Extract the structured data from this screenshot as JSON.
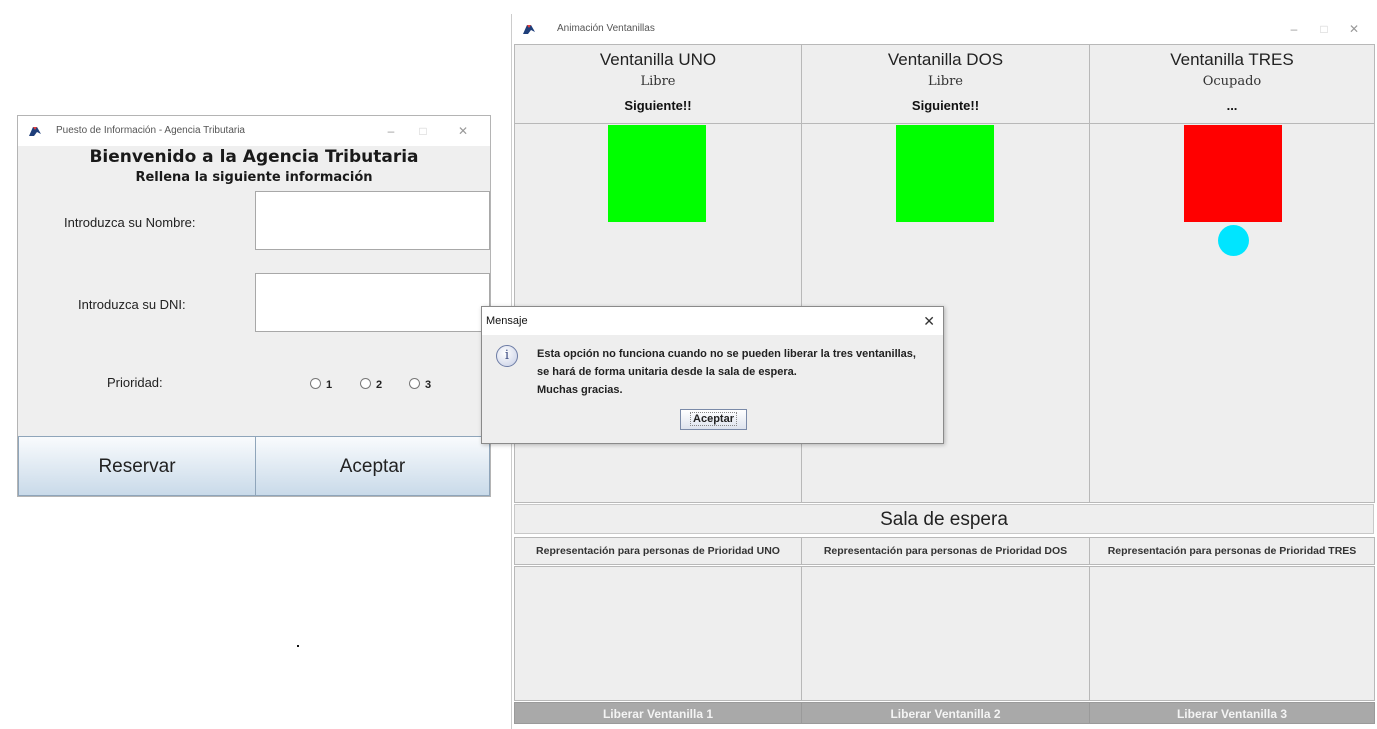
{
  "animation_window": {
    "title": "Animación Ventanillas",
    "controls": {
      "minimize": "–",
      "maximize": "□",
      "close": "✕"
    },
    "windows": [
      {
        "name": "Ventanilla UNO",
        "state": "Libre",
        "next": "Siguiente!!",
        "status_color": "#00ff00",
        "has_client": false
      },
      {
        "name": "Ventanilla DOS",
        "state": "Libre",
        "next": "Siguiente!!",
        "status_color": "#00ff00",
        "has_client": false
      },
      {
        "name": "Ventanilla TRES",
        "state": "Ocupado",
        "next": "...",
        "status_color": "#ff0000",
        "has_client": true
      }
    ],
    "client_color": "#00e5ff",
    "waiting_room": {
      "title": "Sala de espera",
      "headers": [
        "Representación para personas de Prioridad UNO",
        "Representación para personas de Prioridad DOS",
        "Representación para personas de Prioridad TRES"
      ]
    },
    "release_buttons": [
      "Liberar Ventanilla 1",
      "Liberar Ventanilla 2",
      "Liberar Ventanilla 3"
    ]
  },
  "info_window": {
    "title": "Puesto de Información - Agencia Tributaria",
    "controls": {
      "minimize": "–",
      "maximize": "□",
      "close": "✕"
    },
    "welcome": "Bienvenido a la Agencia Tributaria",
    "subtitle": "Rellena la siguiente información",
    "name_label": "Introduzca su Nombre:",
    "name_value": "",
    "dni_label": "Introduzca su DNI:",
    "dni_value": "",
    "priority_label": "Prioridad:",
    "priority_options": [
      "1",
      "2",
      "3"
    ],
    "reserve_button": "Reservar",
    "accept_button": "Aceptar"
  },
  "dialog": {
    "title": "Mensaje",
    "close": "✕",
    "icon": "info-icon",
    "lines": [
      "Esta opción no funciona cuando no se pueden liberar la tres ventanillas,",
      "se hará de forma unitaria desde la sala de espera.",
      "Muchas gracias."
    ],
    "ok_button": "Aceptar"
  }
}
